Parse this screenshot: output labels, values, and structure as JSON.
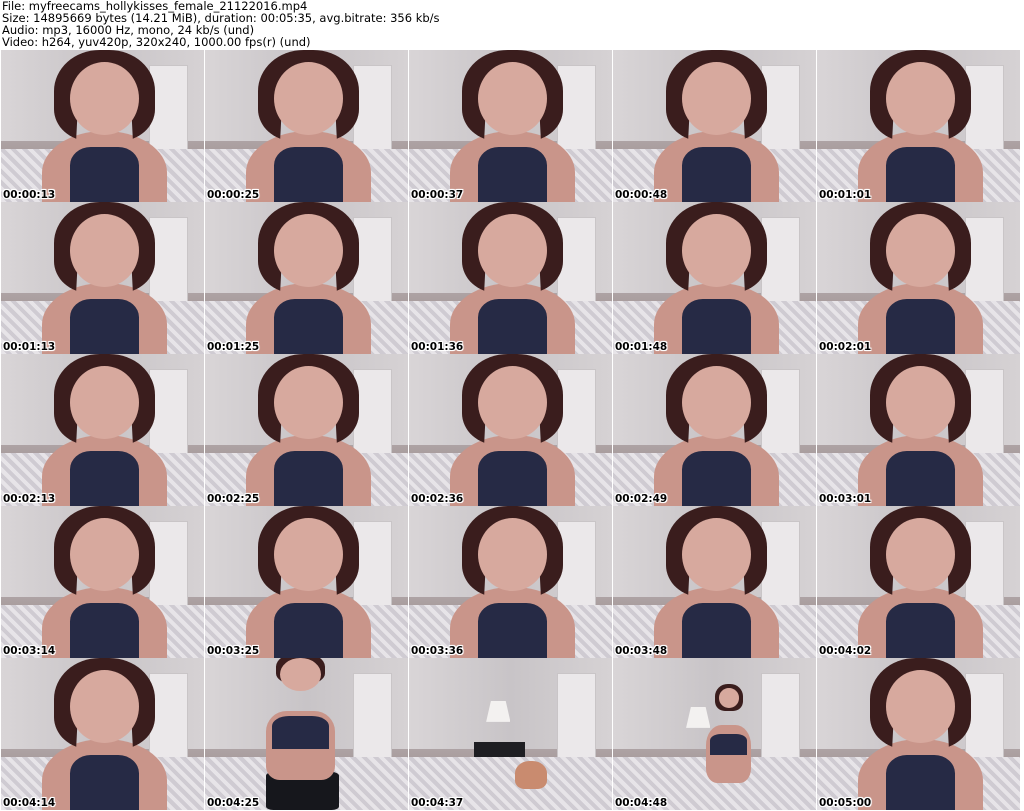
{
  "header": {
    "file": "File: myfreecams_hollykisses_female_21122016.mp4",
    "size": "Size: 14895669 bytes (14.21 MiB), duration: 00:05:35, avg.bitrate: 356 kb/s",
    "audio": "Audio: mp3, 16000 Hz, mono, 24 kb/s (und)",
    "video": "Video: h264, yuv420p, 320x240, 1000.00 fps(r) (und)"
  },
  "thumbnails": [
    {
      "time": "00:00:13",
      "scene": "closeup"
    },
    {
      "time": "00:00:25",
      "scene": "closeup"
    },
    {
      "time": "00:00:37",
      "scene": "closeup"
    },
    {
      "time": "00:00:48",
      "scene": "closeup"
    },
    {
      "time": "00:01:01",
      "scene": "closeup"
    },
    {
      "time": "00:01:13",
      "scene": "closeup"
    },
    {
      "time": "00:01:25",
      "scene": "closeup"
    },
    {
      "time": "00:01:36",
      "scene": "closeup"
    },
    {
      "time": "00:01:48",
      "scene": "closeup"
    },
    {
      "time": "00:02:01",
      "scene": "closeup"
    },
    {
      "time": "00:02:13",
      "scene": "closeup"
    },
    {
      "time": "00:02:25",
      "scene": "closeup"
    },
    {
      "time": "00:02:36",
      "scene": "closeup"
    },
    {
      "time": "00:02:49",
      "scene": "closeup"
    },
    {
      "time": "00:03:01",
      "scene": "closeup"
    },
    {
      "time": "00:03:14",
      "scene": "closeup"
    },
    {
      "time": "00:03:25",
      "scene": "closeup"
    },
    {
      "time": "00:03:36",
      "scene": "closeup"
    },
    {
      "time": "00:03:48",
      "scene": "closeup"
    },
    {
      "time": "00:04:02",
      "scene": "closeup"
    },
    {
      "time": "00:04:14",
      "scene": "closeup"
    },
    {
      "time": "00:04:25",
      "scene": "standing"
    },
    {
      "time": "00:04:37",
      "scene": "away"
    },
    {
      "time": "00:04:48",
      "scene": "far"
    },
    {
      "time": "00:05:00",
      "scene": "closeup"
    }
  ]
}
